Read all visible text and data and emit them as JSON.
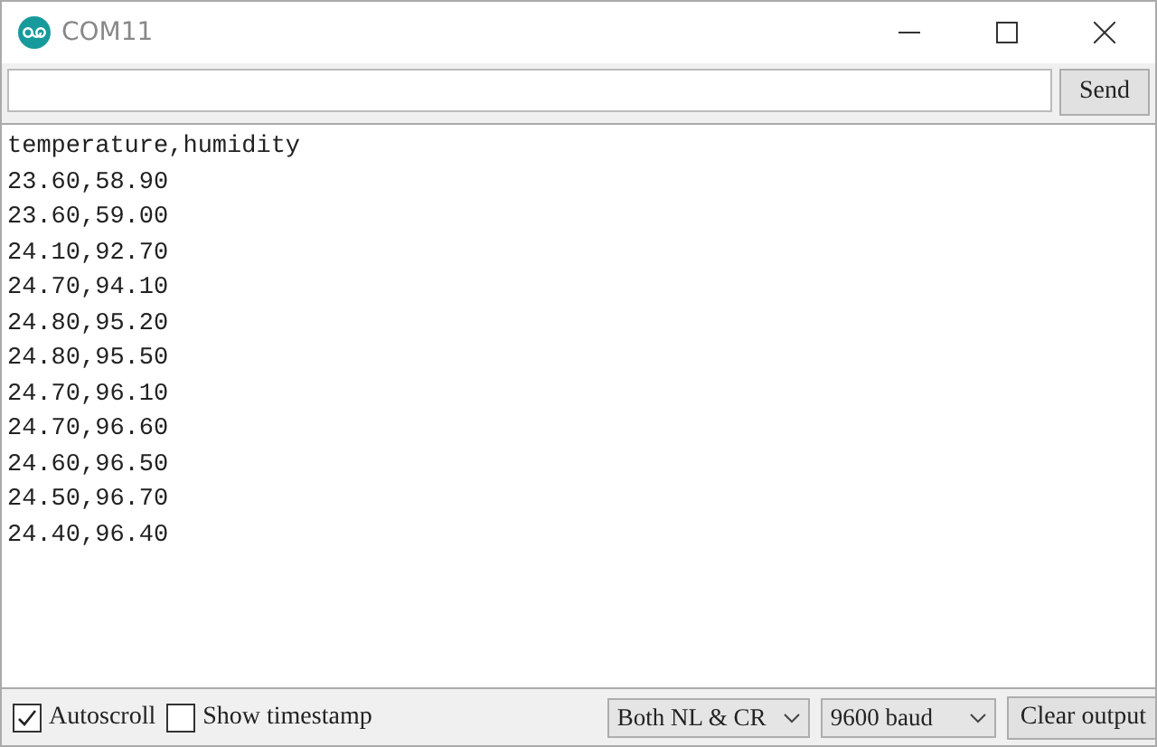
{
  "window": {
    "title": "COM11"
  },
  "send": {
    "button": "Send"
  },
  "output": [
    "temperature,humidity",
    "23.60,58.90",
    "23.60,59.00",
    "24.10,92.70",
    "24.70,94.10",
    "24.80,95.20",
    "24.80,95.50",
    "24.70,96.10",
    "24.70,96.60",
    "24.60,96.50",
    "24.50,96.70",
    "24.40,96.40"
  ],
  "status_bar": {
    "checkboxes": [
      {
        "label": "Autoscroll",
        "checked": true
      },
      {
        "label": "Show timestamp",
        "checked": false
      }
    ],
    "line_ending": "Both NL & CR",
    "baud": "9600 baud",
    "clear_button": "Clear output"
  }
}
